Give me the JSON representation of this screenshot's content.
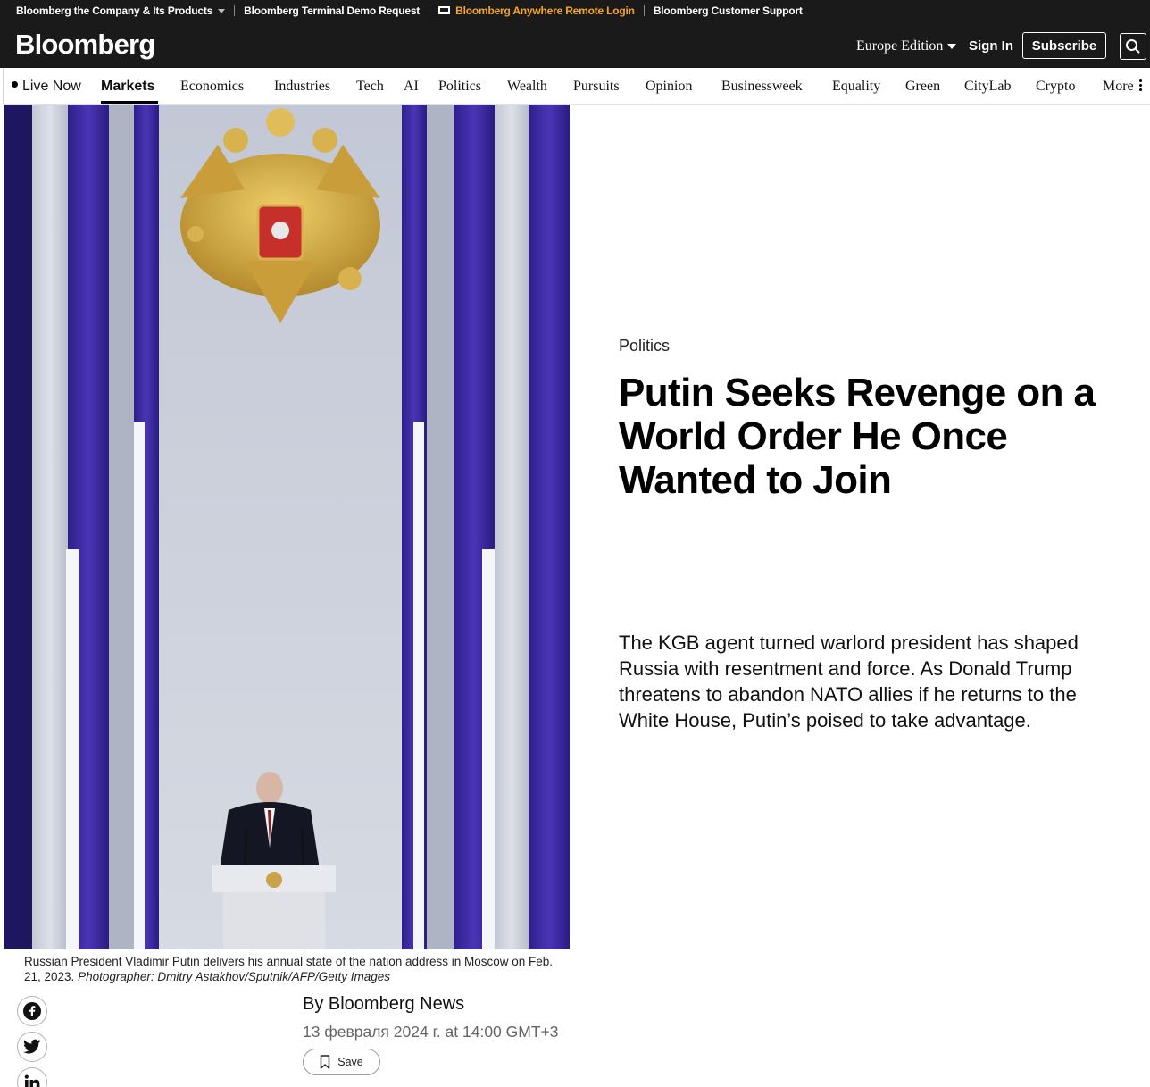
{
  "utility_bar": {
    "company_link": "Bloomberg the Company & Its Products",
    "terminal_link": "Bloomberg Terminal Demo Request",
    "anywhere_link": "Bloomberg Anywhere Remote Login",
    "support_link": "Bloomberg Customer Support",
    "accent_color": "#f5a623"
  },
  "header": {
    "logo": "Bloomberg",
    "edition": "Europe Edition",
    "signin": "Sign In",
    "subscribe": "Subscribe"
  },
  "nav": {
    "live_now": "Live Now",
    "items": [
      "Markets",
      "Economics",
      "Industries",
      "Tech",
      "AI",
      "Politics",
      "Wealth",
      "Pursuits",
      "Opinion",
      "Businessweek",
      "Equality",
      "Green",
      "CityLab",
      "Crypto",
      "More"
    ],
    "active": "Markets"
  },
  "article": {
    "category": "Politics",
    "headline": "Putin Seeks Revenge on a World Order He Once Wanted to Join",
    "dek": "The KGB agent turned warlord president has shaped Russia with resentment and force. As Donald Trump threatens to abandon NATO allies if he returns to the White House, Putin’s poised to take advantage.",
    "caption_text": "Russian President Vladimir Putin delivers his annual state of the nation address in Moscow on Feb. 21, 2023.",
    "caption_credit": "Photographer: Dmitry Astakhov/Sputnik/AFP/Getty Images",
    "byline": "By Bloomberg News",
    "datetime": "13 февраля 2024 г. at 14:00 GMT+3",
    "save_label": "Save"
  },
  "share": {
    "icons": [
      "facebook-icon",
      "twitter-icon",
      "linkedin-icon"
    ]
  }
}
